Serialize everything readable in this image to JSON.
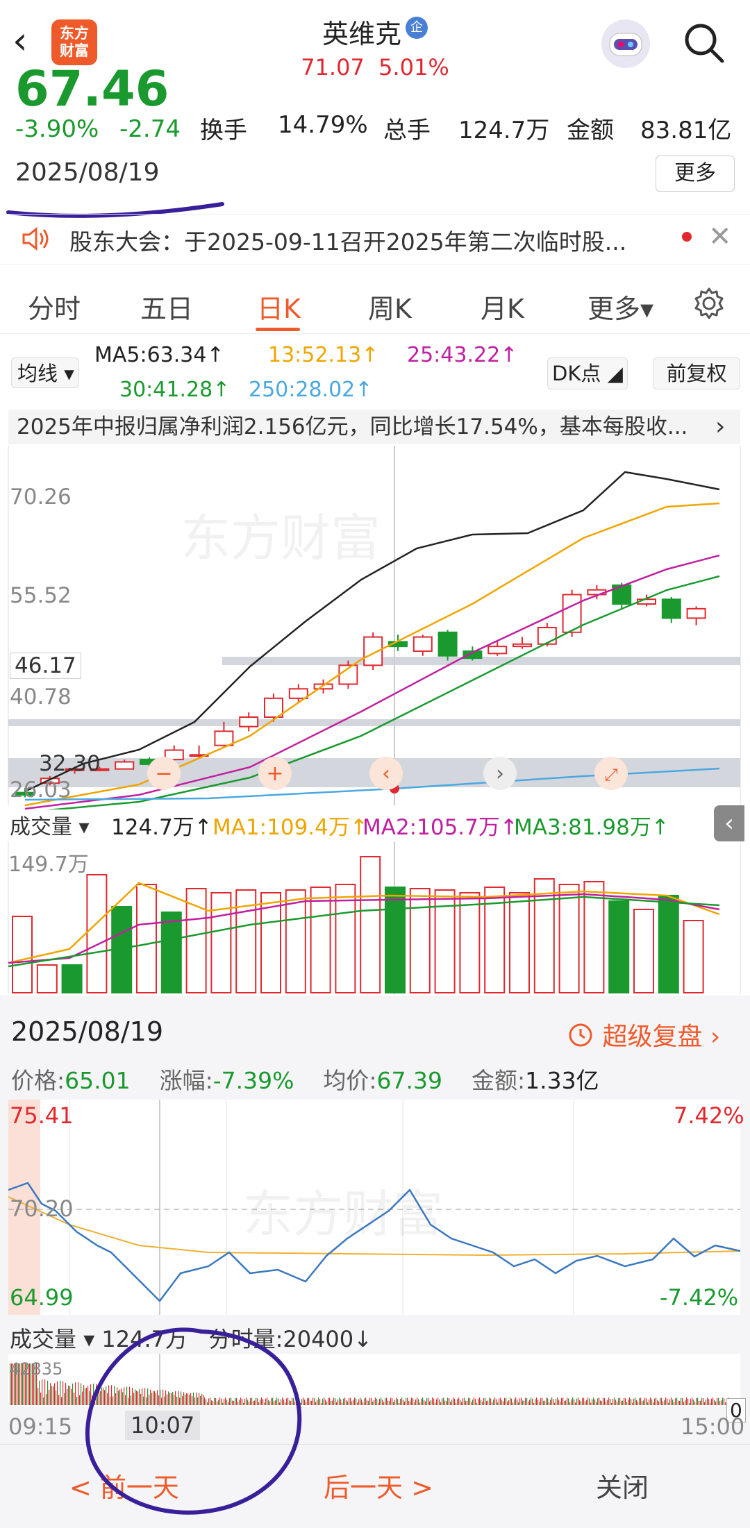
{
  "header": {
    "logo_line1": "东方",
    "logo_line2": "财富",
    "stock_name": "英维克",
    "badge": "企",
    "price": "71.07",
    "change_pct": "5.01%"
  },
  "quote": {
    "big_price": "67.46",
    "pct": "-3.90%",
    "chg": "-2.74",
    "turnover_label": "换手",
    "turnover": "14.79%",
    "volume_label": "总手",
    "volume": "124.7万",
    "amount_label": "金额",
    "amount": "83.81亿",
    "date": "2025/08/19",
    "more": "更多"
  },
  "notice": {
    "text": "股东大会：于2025-09-11召开2025年第二次临时股...",
    "close": "✕"
  },
  "tabs": [
    "分时",
    "五日",
    "日K",
    "周K",
    "月K",
    "更多▾"
  ],
  "active_tab": "日K",
  "ma": {
    "select": "均线",
    "ma5": "MA5:63.34↑",
    "ma13": "13:52.13↑",
    "ma25": "25:43.22↑",
    "ma30": "30:41.28↑",
    "ma250": "250:28.02↑",
    "dk": "DK点",
    "fq": "前复权"
  },
  "report": "2025年中报归属净利润2.156亿元，同比增长17.54%，基本每股收...",
  "kchart_labels": {
    "y1": "70.26",
    "y2": "55.52",
    "y3": "46.17",
    "y4": "40.78",
    "y5": "32.30",
    "y6": "26.03"
  },
  "volume_row": {
    "select": "成交量",
    "value": "124.7万↑",
    "ma1": "MA1:109.4万↑",
    "ma2": "MA2:105.7万↑",
    "ma3": "MA3:81.98万↑",
    "max": "149.7万"
  },
  "intraday": {
    "date": "2025/08/19",
    "replay": "超级复盘",
    "price_label": "价格:",
    "price": "65.01",
    "chg_label": "涨幅:",
    "chg": "-7.39%",
    "avg_label": "均价:",
    "avg": "67.39",
    "amt_label": "金额:",
    "amt": "1.33亿",
    "max": "75.41",
    "mid": "70.20",
    "min": "64.99",
    "pmax": "7.42%",
    "pmin": "-7.42%",
    "vol_select": "成交量",
    "vol_value": "124.7万",
    "vol_min": "分时量:20400↓",
    "vol_max": "42835",
    "vol_zero": "0",
    "t_start": "09:15",
    "t_cursor": "10:07",
    "t_end": "15:00"
  },
  "footer": {
    "prev": "< 前一天",
    "next": "后一天 >",
    "close": "关闭"
  },
  "colors": {
    "up": "#e0282e",
    "down": "#1a9a2e",
    "accent": "#ef5a2a",
    "ma5": "#222222",
    "ma13": "#f0a500",
    "ma25": "#c020a0",
    "ma30": "#1a9a2e",
    "ma250": "#4aa8e0"
  }
}
